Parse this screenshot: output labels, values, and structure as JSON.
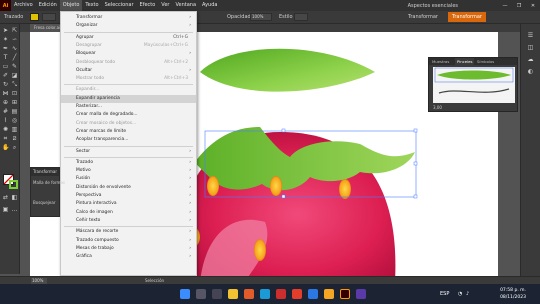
{
  "menubar": {
    "logo": "Ai",
    "items": [
      "Archivo",
      "Edición",
      "Objeto",
      "Texto",
      "Seleccionar",
      "Efecto",
      "Ver",
      "Ventana",
      "Ayuda"
    ],
    "active_index": 2,
    "workspace": "Aspectos esenciales",
    "window_controls": [
      "—",
      "❐",
      "✕"
    ]
  },
  "controlbar": {
    "label": "Trazado",
    "stroke_label": "Opacidad",
    "opacity_value": "100%",
    "style_label": "Estilo",
    "transform_label": "Transformar",
    "orange_button": "Transformar"
  },
  "document": {
    "tab_label": "Fresa color.ai* al 100 % (RGB/Previsualizar)"
  },
  "object_menu": {
    "items": [
      {
        "label": "Transformar",
        "shortcut": "",
        "submenu": true,
        "disabled": false
      },
      {
        "label": "Organizar",
        "shortcut": "",
        "submenu": true,
        "disabled": false
      },
      {
        "sep": true
      },
      {
        "label": "Agrupar",
        "shortcut": "Ctrl+G",
        "submenu": false,
        "disabled": false
      },
      {
        "label": "Desagrupar",
        "shortcut": "Mayúsculas+Ctrl+G",
        "submenu": false,
        "disabled": true
      },
      {
        "label": "Bloquear",
        "shortcut": "",
        "submenu": true,
        "disabled": false
      },
      {
        "label": "Desbloquear todo",
        "shortcut": "Alt+Ctrl+2",
        "submenu": false,
        "disabled": true
      },
      {
        "label": "Ocultar",
        "shortcut": "",
        "submenu": true,
        "disabled": false
      },
      {
        "label": "Mostrar todo",
        "shortcut": "Alt+Ctrl+3",
        "submenu": false,
        "disabled": true
      },
      {
        "sep": true
      },
      {
        "label": "Expandir...",
        "shortcut": "",
        "submenu": false,
        "disabled": true
      },
      {
        "label": "Expandir apariencia",
        "shortcut": "",
        "submenu": false,
        "disabled": false,
        "highlight": true
      },
      {
        "label": "Rasterizar...",
        "shortcut": "",
        "submenu": false,
        "disabled": false
      },
      {
        "label": "Crear malla de degradado...",
        "shortcut": "",
        "submenu": false,
        "disabled": false
      },
      {
        "label": "Crear mosaico de objetos...",
        "shortcut": "",
        "submenu": false,
        "disabled": true
      },
      {
        "label": "Crear marcas de límite",
        "shortcut": "",
        "submenu": false,
        "disabled": false
      },
      {
        "label": "Acoplar transparencia...",
        "shortcut": "",
        "submenu": false,
        "disabled": false
      },
      {
        "sep": true
      },
      {
        "label": "Sector",
        "shortcut": "",
        "submenu": true,
        "disabled": false
      },
      {
        "sep": true
      },
      {
        "label": "Trazado",
        "shortcut": "",
        "submenu": true,
        "disabled": false
      },
      {
        "label": "Motivo",
        "shortcut": "",
        "submenu": true,
        "disabled": false
      },
      {
        "label": "Fusión",
        "shortcut": "",
        "submenu": true,
        "disabled": false
      },
      {
        "label": "Distorsión de envolvente",
        "shortcut": "",
        "submenu": true,
        "disabled": false
      },
      {
        "label": "Perspectiva",
        "shortcut": "",
        "submenu": true,
        "disabled": false
      },
      {
        "label": "Pintura interactiva",
        "shortcut": "",
        "submenu": true,
        "disabled": false
      },
      {
        "label": "Calco de imagen",
        "shortcut": "",
        "submenu": true,
        "disabled": false
      },
      {
        "label": "Ceñir texto",
        "shortcut": "",
        "submenu": true,
        "disabled": false
      },
      {
        "sep": true
      },
      {
        "label": "Máscara de recorte",
        "shortcut": "",
        "submenu": true,
        "disabled": false
      },
      {
        "label": "Trazado compuesto",
        "shortcut": "",
        "submenu": true,
        "disabled": false
      },
      {
        "label": "Mesas de trabajo",
        "shortcut": "",
        "submenu": true,
        "disabled": false
      },
      {
        "label": "Gráfica",
        "shortcut": "",
        "submenu": true,
        "disabled": false
      }
    ]
  },
  "transform_panel": {
    "title": "Transformar",
    "row1": "Malla de formas",
    "row2": "Bosquejear"
  },
  "brush_panel": {
    "tabs": [
      "Muestras",
      "Pinceles",
      "Símbolos"
    ],
    "active_tab": 1,
    "footer_value": "3,00"
  },
  "statusbar": {
    "zoom": "100%",
    "selection": "Selección"
  },
  "taskbar": {
    "time": "07:58 p. m.",
    "date": "08/11/2023",
    "lang": "ESP"
  },
  "colors": {
    "accent_orange": "#d9670c",
    "ui_dark": "#323232",
    "strawberry_red": "#d81b4a",
    "leaf_green": "#6dbb2e"
  }
}
